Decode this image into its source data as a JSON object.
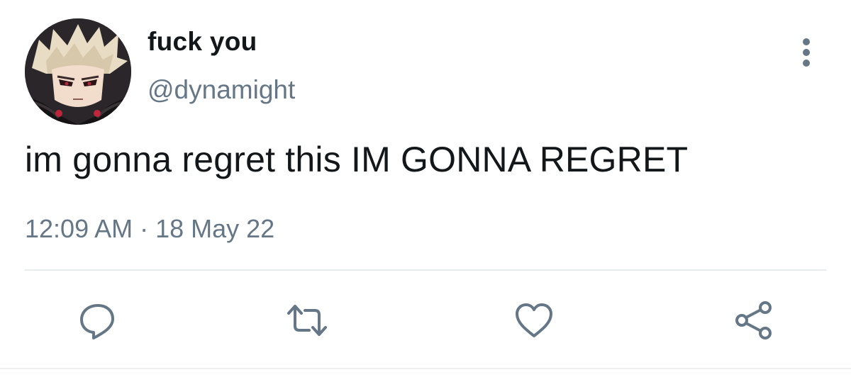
{
  "user": {
    "display_name": "fuck you",
    "handle": "@dynamight",
    "avatar": "anime-character-avatar"
  },
  "tweet": {
    "text": "im gonna regret this IM GONNA REGRET",
    "timestamp": "12:09 AM · 18 May 22"
  },
  "actions": [
    {
      "name": "reply",
      "icon": "comment-icon"
    },
    {
      "name": "retweet",
      "icon": "retweet-icon"
    },
    {
      "name": "like",
      "icon": "heart-icon"
    },
    {
      "name": "share",
      "icon": "share-icon"
    }
  ],
  "colors": {
    "text": "#14171a",
    "secondary": "#657786",
    "divider": "#e6ecf0",
    "background": "#ffffff"
  }
}
